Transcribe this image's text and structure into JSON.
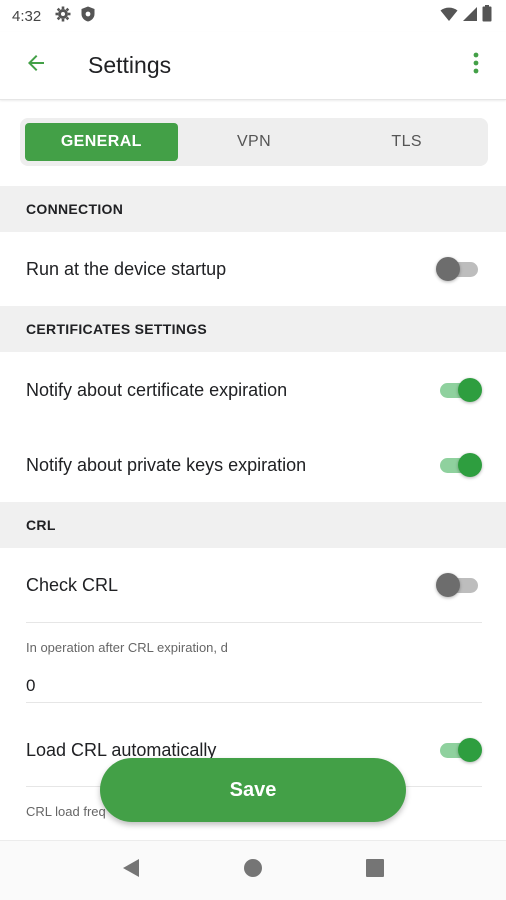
{
  "status_bar": {
    "time": "4:32",
    "left_icons": [
      "gear-icon",
      "shield-icon"
    ],
    "right_icons": [
      "wifi-icon",
      "signal-icon",
      "battery-icon"
    ]
  },
  "app_bar": {
    "title": "Settings",
    "back_icon": "arrow-left-icon",
    "menu_icon": "more-vert-icon"
  },
  "tabs": [
    {
      "label": "GENERAL",
      "active": true
    },
    {
      "label": "VPN",
      "active": false
    },
    {
      "label": "TLS",
      "active": false
    }
  ],
  "sections": {
    "connection": {
      "header": "CONNECTION",
      "run_at_startup": {
        "label": "Run at the device startup",
        "enabled": false
      }
    },
    "certificates": {
      "header": "CERTIFICATES SETTINGS",
      "notify_cert_expiration": {
        "label": "Notify about certificate expiration",
        "enabled": true
      },
      "notify_keys_expiration": {
        "label": "Notify about private keys expiration",
        "enabled": true
      }
    },
    "crl": {
      "header": "CRL",
      "check_crl": {
        "label": "Check CRL",
        "enabled": false
      },
      "operation_after_expiration": {
        "label": "In operation after CRL expiration, d",
        "value": "0"
      },
      "load_automatically": {
        "label": "Load CRL automatically",
        "enabled": true
      },
      "load_frequency_label": "CRL load freq"
    }
  },
  "save_button": {
    "label": "Save"
  },
  "nav_bar": {
    "icons": [
      "back-triangle-icon",
      "home-circle-icon",
      "recents-square-icon"
    ]
  },
  "colors": {
    "accent": "#43a047",
    "switch_on_thumb": "#2e9e3f",
    "switch_on_track": "#8fd19e",
    "switch_off_thumb": "#6d6d6d",
    "section_bg": "#f0f0f0"
  }
}
